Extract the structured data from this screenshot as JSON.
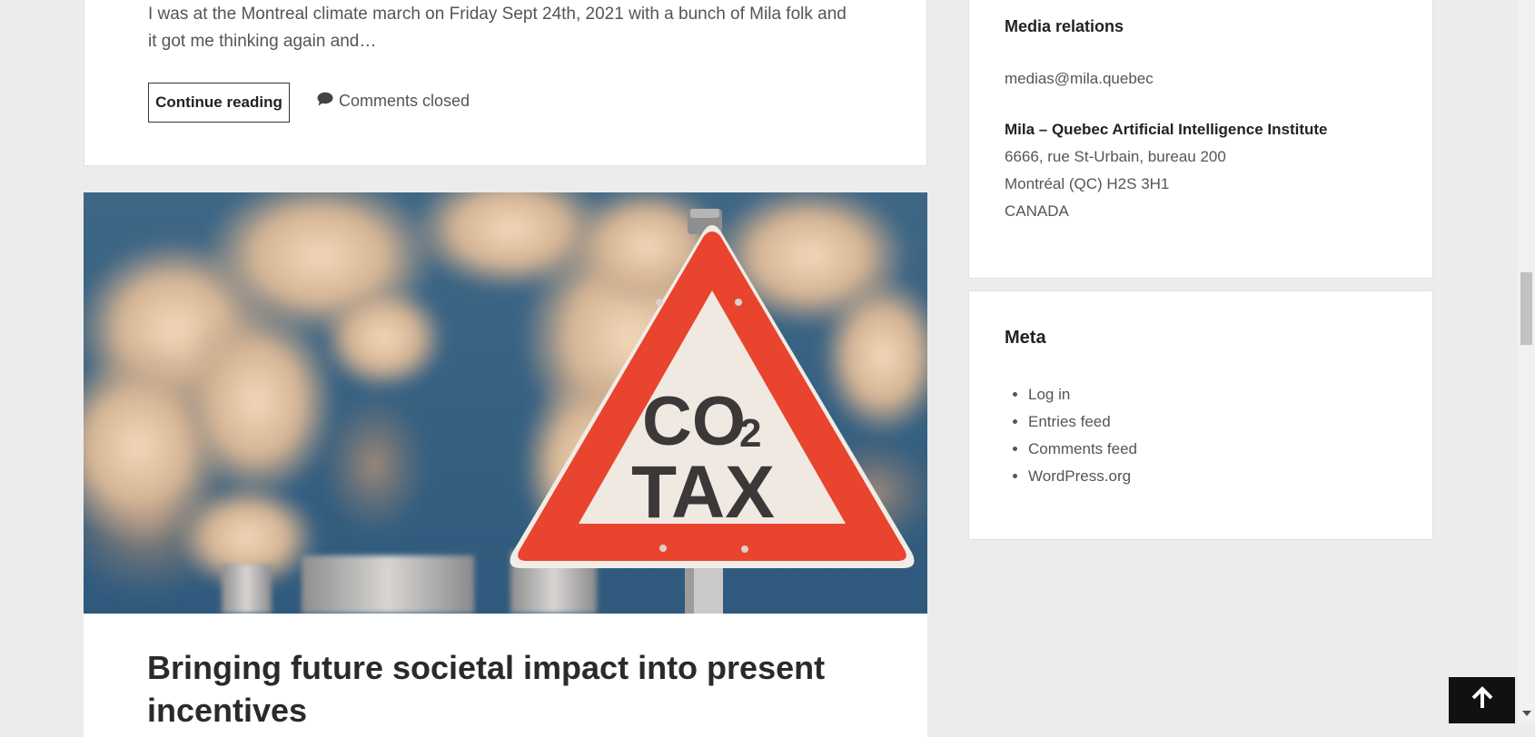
{
  "post1": {
    "excerpt": "I was at the Montreal climate march on Friday Sept 24th, 2021 with a bunch of Mila folk and it got me thinking again and…",
    "continue_label": "Continue reading",
    "comments_label": "Comments closed",
    "comments_icon": "speech-bubble-icon"
  },
  "post2": {
    "image_sign_line1": "CO",
    "image_sign_sub": "2",
    "image_sign_line2": "TAX",
    "title": "Bringing future societal impact into present incentives"
  },
  "sidebar": {
    "media": {
      "title": "Media relations",
      "email": "medias@mila.quebec",
      "org": "Mila – Quebec Artificial Intelligence Institute",
      "address1": "6666, rue St-Urbain, bureau 200",
      "address2": "Montréal (QC) H2S 3H1",
      "country": "CANADA"
    },
    "meta": {
      "title": "Meta",
      "links": [
        "Log in",
        "Entries feed",
        "Comments feed",
        "WordPress.org"
      ]
    }
  },
  "back_to_top_icon": "arrow-up-icon",
  "colors": {
    "sign_red": "#e9442e",
    "background": "#ececec",
    "button_dark": "#111111"
  }
}
